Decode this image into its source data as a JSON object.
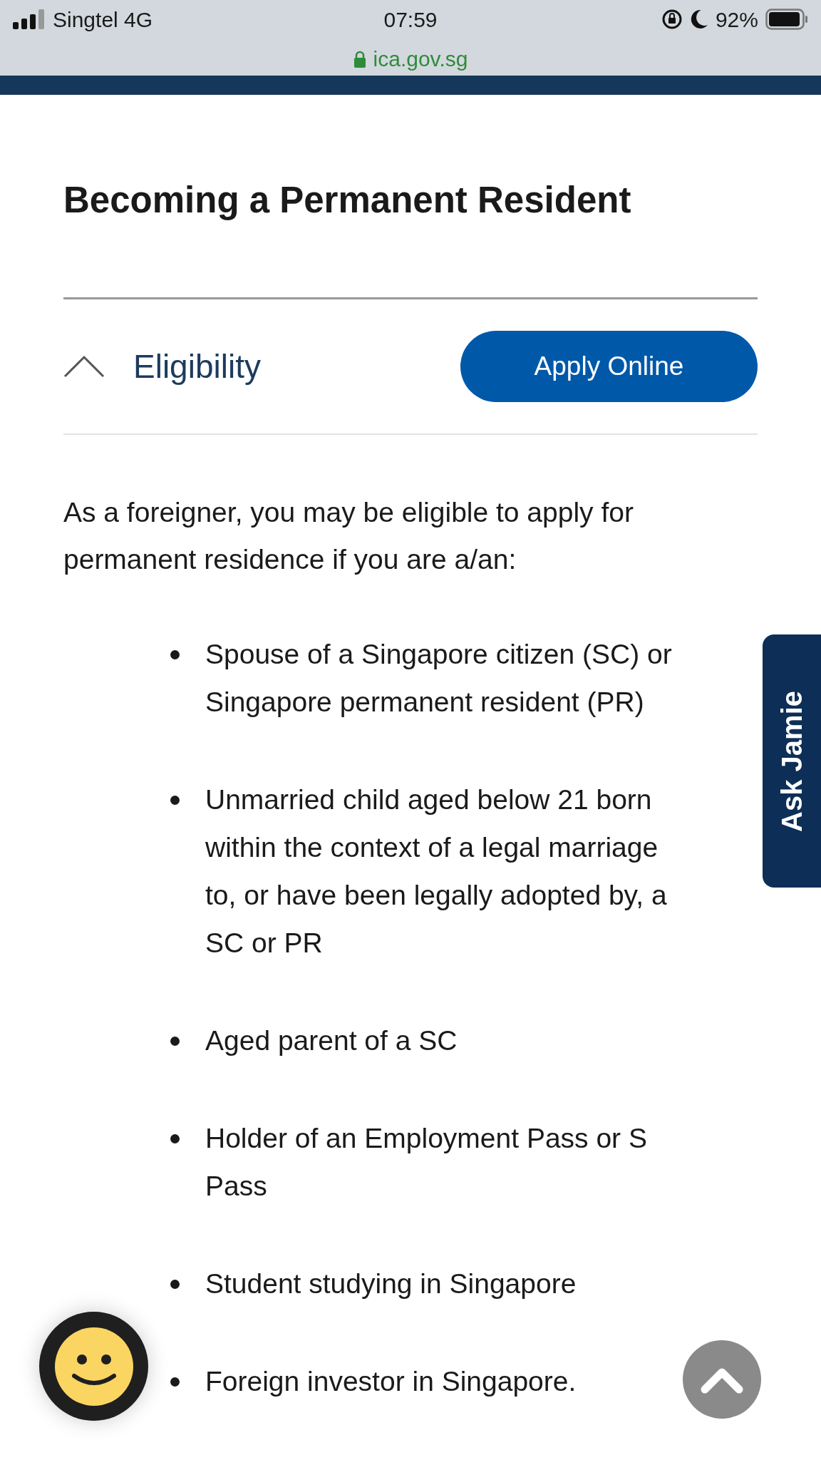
{
  "status_bar": {
    "carrier": "Singtel 4G",
    "time": "07:59",
    "battery": "92%"
  },
  "address_bar": {
    "url": "ica.gov.sg"
  },
  "page_title": "Becoming a Permanent Resident",
  "accordion": {
    "label": "Eligibility",
    "expanded": true
  },
  "apply_button": "Apply Online",
  "intro": "As a foreigner, you may be eligible to apply for permanent residence if you are a/an:",
  "items": [
    "Spouse of a Singapore citizen (SC) or Singapore permanent resident (PR)",
    "Unmarried child aged below 21 born within the context of a legal marriage to, or have been legally adopted by, a SC or PR",
    "Aged parent of a SC",
    "Holder of an Employment Pass or S Pass",
    "Student studying in Singapore",
    "Foreign investor in Singapore."
  ],
  "side_tab": "Ask Jamie"
}
